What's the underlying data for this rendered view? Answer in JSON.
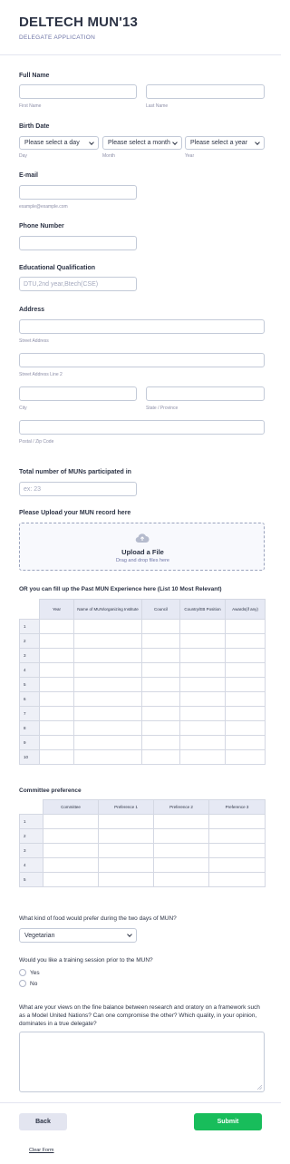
{
  "header": {
    "title": "DELTECH MUN'13",
    "subtitle": "DELEGATE APPLICATION"
  },
  "full_name": {
    "label": "Full Name",
    "first_sub": "First Name",
    "last_sub": "Last Name"
  },
  "birth_date": {
    "label": "Birth Date",
    "day_value": "Please select a day",
    "month_value": "Please select a month",
    "year_value": "Please select a year",
    "day_sub": "Day",
    "month_sub": "Month",
    "year_sub": "Year"
  },
  "email": {
    "label": "E-mail",
    "sub": "example@example.com"
  },
  "phone": {
    "label": "Phone Number"
  },
  "education": {
    "label": "Educational Qualification",
    "placeholder": "DTU,2nd year,Btech(CSE)"
  },
  "address": {
    "label": "Address",
    "street_sub": "Street Address",
    "street2_sub": "Street Address Line 2",
    "city_sub": "City",
    "state_sub": "State / Province",
    "postal_sub": "Postal / Zip Code"
  },
  "muns": {
    "label": "Total number of MUNs participated in",
    "placeholder": "ex: 23"
  },
  "upload": {
    "label": "Please Upload your MUN record here",
    "title": "Upload a File",
    "hint": "Drag and drop files here"
  },
  "past_table": {
    "label": "OR you can fill up the Past MUN Experience here (List 10 Most Relevant)",
    "headers": [
      "Year",
      "Name of MUN/organizing Institute",
      "Council",
      "Country/EB Position",
      "Awards(if any)"
    ],
    "rows": [
      "1",
      "2",
      "3",
      "4",
      "5",
      "6",
      "7",
      "8",
      "9",
      "10"
    ]
  },
  "committee_table": {
    "label": "Committee preference",
    "headers": [
      "Committee",
      "Preference 1",
      "Preference 2",
      "Preference 3"
    ],
    "rows": [
      "1",
      "2",
      "3",
      "4",
      "5"
    ]
  },
  "food": {
    "label": "What kind of food would prefer during the two days of MUN?",
    "value": "Vegetarian"
  },
  "training": {
    "label": "Would you like a training session prior to the MUN?",
    "options": [
      "Yes",
      "No"
    ]
  },
  "views": {
    "label": "What are your views on the fine balance between research and oratory on a framework such as a Model United Nations? Can one compromise the other? Which quality, in your opinion, dominates in a true delegate?"
  },
  "footer": {
    "back": "Back",
    "submit": "Submit",
    "clear": "Clear Form"
  },
  "colors": {
    "submit": "#18bd5b",
    "back": "#e3e5f0",
    "accent": "#2c3345"
  }
}
